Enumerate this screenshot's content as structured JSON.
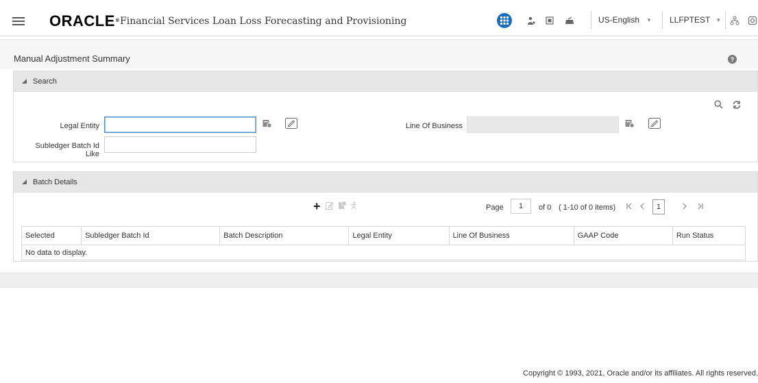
{
  "header": {
    "logo": "ORACLE",
    "logo_mark": "®",
    "app_title": "Financial Services Loan Loss Forecasting and Provisioning",
    "language": "US-English",
    "user": "LLFPTEST",
    "icons": [
      "menu-icon",
      "apps-icon",
      "user-admin-icon",
      "object-admin-icon",
      "notification-icon",
      "org-chart-icon",
      "logout-icon"
    ]
  },
  "page": {
    "title": "Manual Adjustment Summary",
    "help": "?"
  },
  "search": {
    "section_title": "Search",
    "legal_entity_label": "Legal Entity",
    "legal_entity_value": "",
    "subledger_label": "Subledger Batch Id Like",
    "subledger_value": "",
    "line_of_business_label": "Line Of Business",
    "line_of_business_value": ""
  },
  "batch": {
    "section_title": "Batch Details",
    "pager": {
      "page_label": "Page",
      "current_page": "1",
      "of_text": "of 0",
      "items_text": "( 1-10 of 0 items)",
      "page_number": "1"
    },
    "columns": [
      "Selected",
      "Subledger Batch Id",
      "Batch Description",
      "Legal Entity",
      "Line Of Business",
      "GAAP Code",
      "Run Status"
    ],
    "empty_text": "No data to display."
  },
  "footer": {
    "copyright": "Copyright © 1993, 2021, Oracle and/or its affiliates. All rights reserved."
  },
  "colors": {
    "accent": "#1a6ec0",
    "focus_border": "#4d90d0",
    "panel_header": "#e6e6e6"
  }
}
